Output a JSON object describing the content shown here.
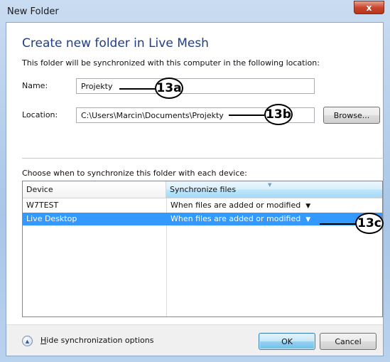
{
  "window": {
    "title": "New Folder",
    "close_icon": "close-icon",
    "close_glyph": "x"
  },
  "dialog": {
    "heading": "Create new folder in Live Mesh",
    "subtitle": "This folder will be synchronized with this computer in the following location:",
    "name_label": "Name:",
    "name_value": "Projekty",
    "location_label": "Location:",
    "location_value": "C:\\Users\\Marcin\\Documents\\Projekty",
    "browse_label": "Browse...",
    "choose_text": "Choose when to synchronize this folder with each device:"
  },
  "devices_table": {
    "columns": [
      "Device",
      "Synchronize files"
    ],
    "rows": [
      {
        "device": "W7TEST",
        "sync": "When files are added or modified",
        "dropdown_icon": "triangle-down-icon",
        "selected": false
      },
      {
        "device": "Live Desktop",
        "sync": "When files are added or modified",
        "dropdown_icon": "triangle-down-icon",
        "selected": true
      }
    ]
  },
  "footer": {
    "toggle_icon": "chevron-up-icon",
    "hide_hotkey": "H",
    "hide_label_rest": "ide synchronization options",
    "ok_label": "OK",
    "cancel_label": "Cancel"
  },
  "callouts": [
    "13a",
    "13b",
    "13c"
  ],
  "colors": {
    "heading": "#1e3e8c",
    "selection": "#3399ff",
    "window_frame": "#a9c6e8",
    "close_button": "#c9472f"
  }
}
